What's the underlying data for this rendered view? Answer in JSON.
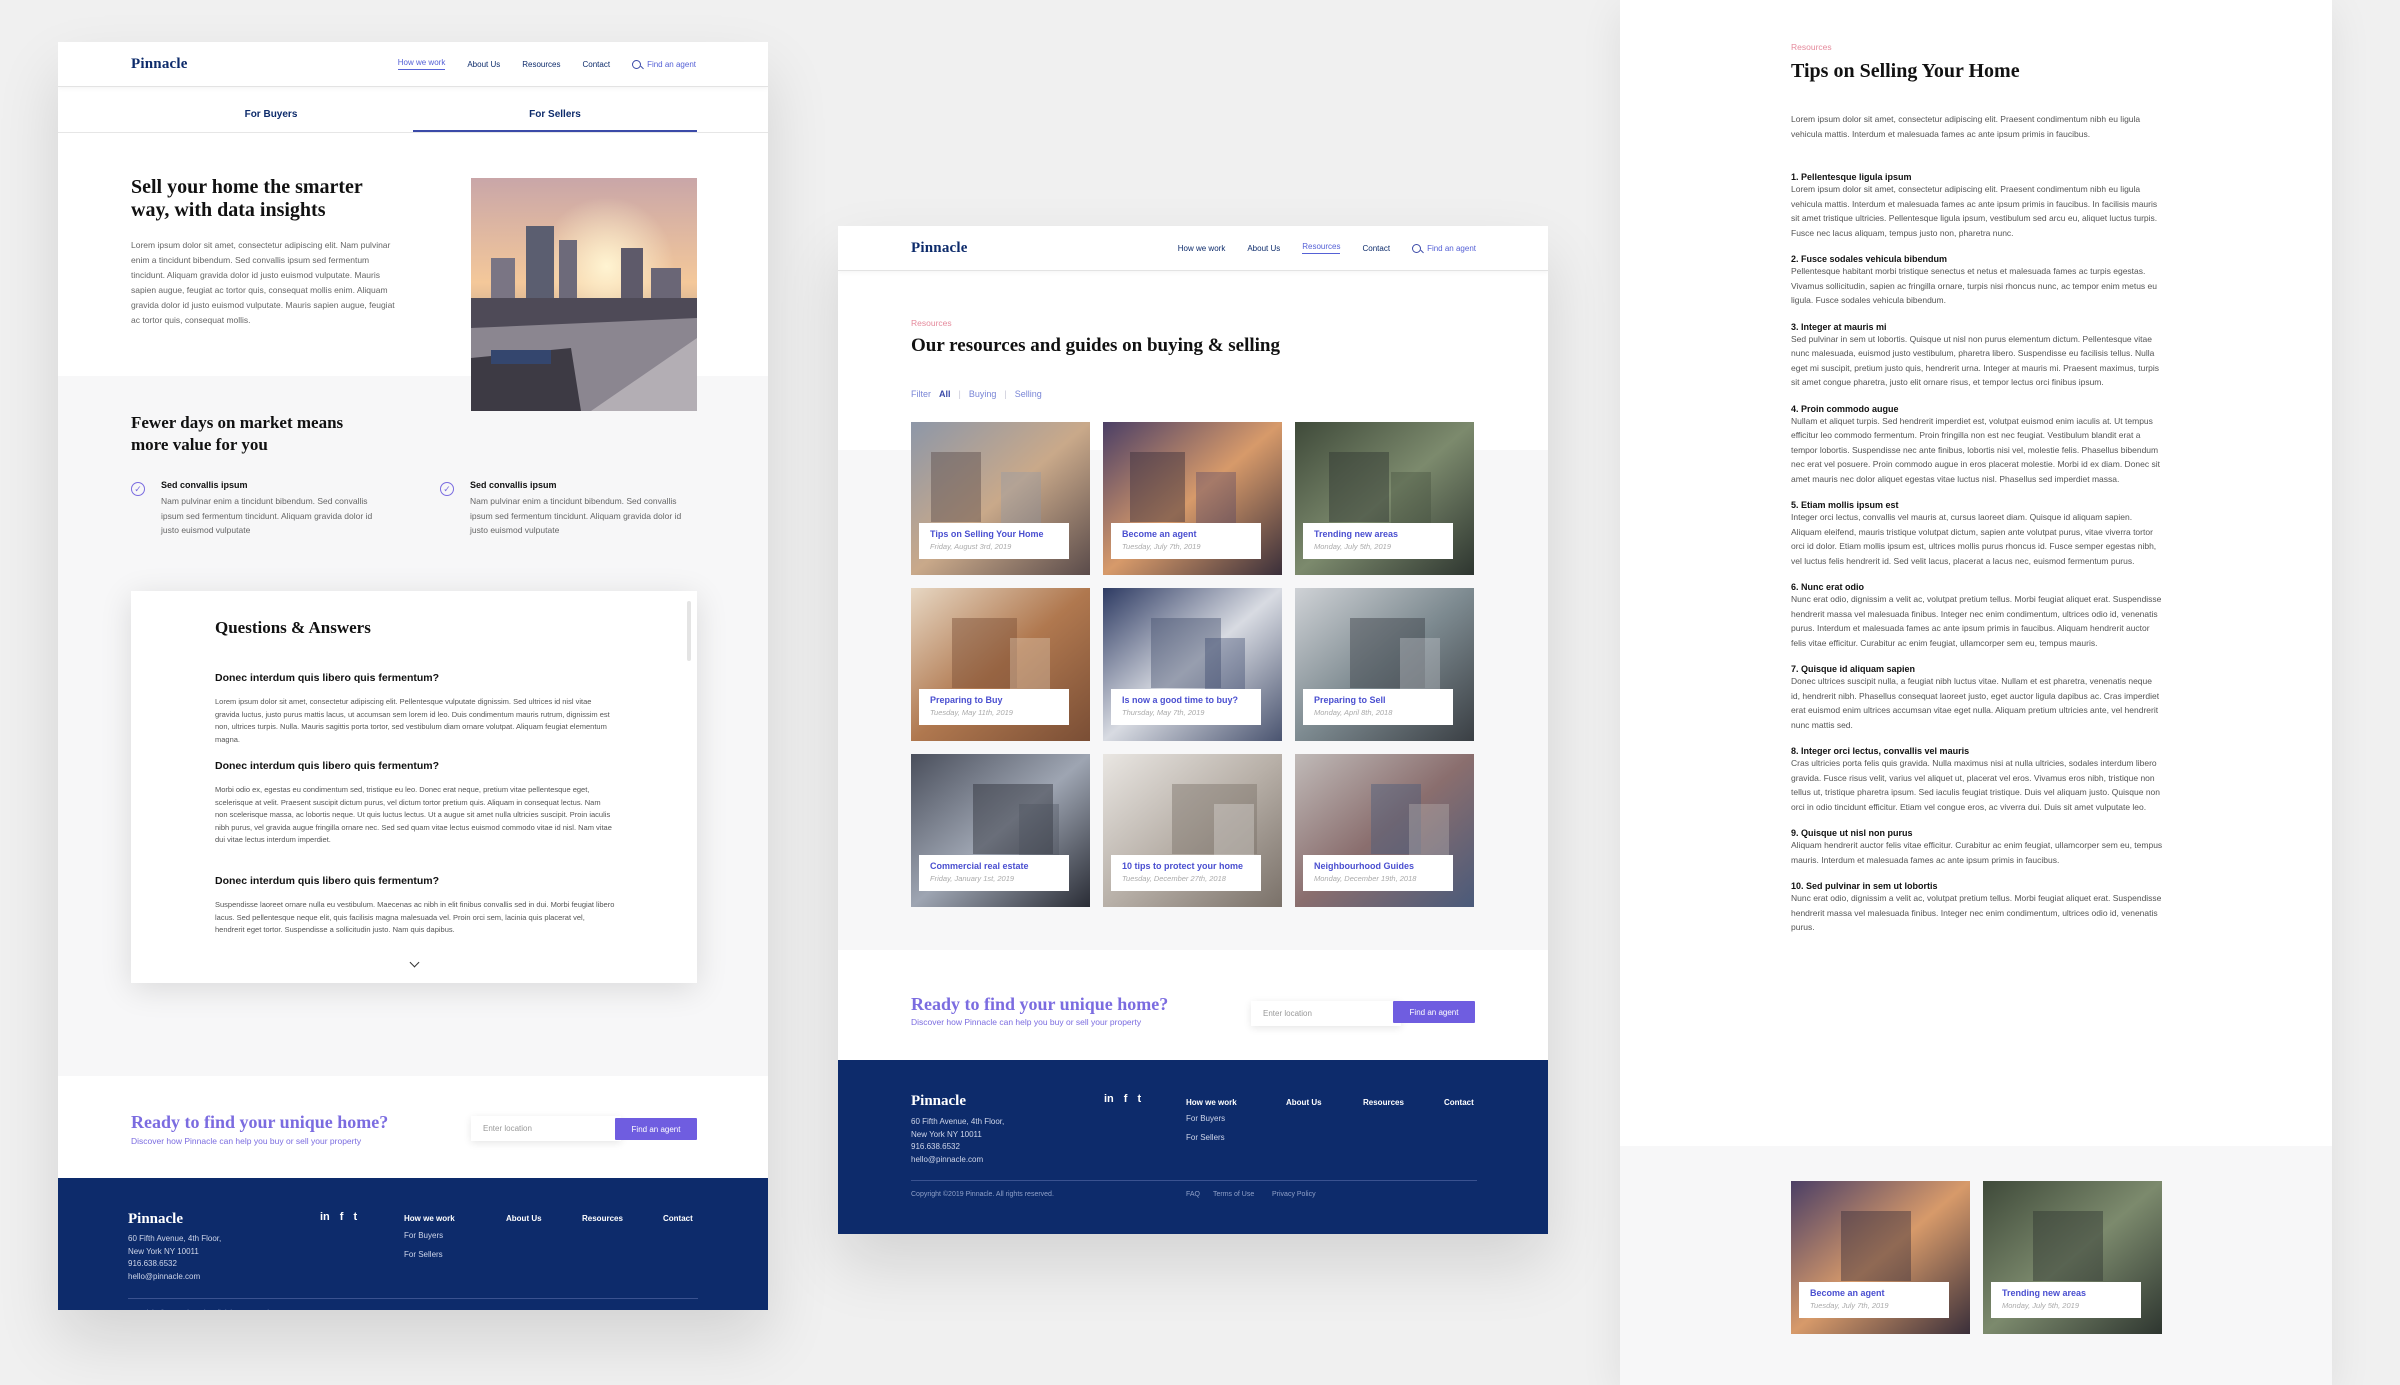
{
  "brand": "Pinnacle",
  "nav": {
    "how_we_work": "How we work",
    "about_us": "About Us",
    "resources": "Resources",
    "contact": "Contact",
    "find_agent": "Find an agent"
  },
  "sellers_page": {
    "tabs": [
      "For Buyers",
      "For Sellers"
    ],
    "hero_title": "Sell your home the smarter way, with data insights",
    "hero_body": "Lorem ipsum dolor sit amet, consectetur adipiscing elit. Nam pulvinar enim a tincidunt bibendum. Sed convallis ipsum sed fermentum tincidunt. Aliquam gravida dolor id justo euismod vulputate. Mauris sapien augue, feugiat ac tortor quis, consequat mollis enim. Aliquam gravida dolor id justo euismod vulputate. Mauris sapien augue, feugiat ac tortor quis, consequat mollis.",
    "section_title": "Fewer days on market means more value for you",
    "features": [
      {
        "title": "Sed convallis ipsum",
        "body": "Nam pulvinar enim a tincidunt bibendum. Sed convallis ipsum sed fermentum tincidunt. Aliquam gravida dolor id justo euismod vulputate"
      },
      {
        "title": "Sed convallis ipsum",
        "body": "Nam pulvinar enim a tincidunt bibendum. Sed convallis ipsum sed fermentum tincidunt. Aliquam gravida dolor id justo euismod vulputate"
      }
    ],
    "qa_title": "Questions & Answers",
    "qa": [
      {
        "q": "Donec interdum quis libero quis fermentum?",
        "a": "Lorem ipsum dolor sit amet, consectetur adipiscing elit. Pellentesque vulputate dignissim. Sed ultrices id nisl vitae gravida luctus, justo purus mattis lacus, ut accumsan sem lorem id leo. Duis condimentum mauris rutrum, dignissim est non, ultrices turpis. Nulla. Mauris sagittis porta tortor, sed vestibulum diam ornare volutpat. Aliquam feugiat elementum magna."
      },
      {
        "q": "Donec interdum quis libero quis fermentum?",
        "a": "Morbi odio ex, egestas eu condimentum sed, tristique eu leo. Donec erat neque, pretium vitae pellentesque eget, scelerisque at velit. Praesent suscipit dictum purus, vel dictum tortor pretium quis. Aliquam in consequat lectus. Nam non scelerisque massa, ac lobortis neque. Ut quis luctus lectus. Ut a augue sit amet nulla ultricies suscipit. Proin iaculis nibh purus, vel gravida augue fringilla ornare nec. Sed sed quam vitae lectus euismod commodo vitae id nisl. Nam vitae dui vitae lectus interdum imperdiet."
      },
      {
        "q": "Donec interdum quis libero quis fermentum?",
        "a": "Suspendisse laoreet ornare nulla eu vestibulum. Maecenas ac nibh in elit finibus convallis sed in dui. Morbi feugiat libero lacus. Sed pellentesque neque elit, quis facilisis magna malesuada vel. Proin orci sem, lacinia quis placerat vel, hendrerit eget tortor. Suspendisse a sollicitudin justo. Nam quis dapibus."
      }
    ]
  },
  "cta": {
    "title": "Ready to find your unique home?",
    "subtitle": "Discover how Pinnacle can help you buy or sell your property",
    "placeholder": "Enter location",
    "button": "Find an agent"
  },
  "footer": {
    "address": [
      "60 Fifth Avenue, 4th Floor,",
      "New York NY 10011",
      "916.638.6532",
      "hello@pinnacle.com"
    ],
    "social": [
      "in",
      "f",
      "t"
    ],
    "cols": [
      "How we work",
      "About Us",
      "Resources",
      "Contact"
    ],
    "how_sub": [
      "For Buyers",
      "For Sellers"
    ],
    "copyright": "Copyright ©2019 Pinnacle. All rights reserved.",
    "links": [
      "FAQ",
      "Terms of Use",
      "Privacy Policy"
    ]
  },
  "resources_page": {
    "crumb": "Resources",
    "title": "Our resources and guides on buying & selling",
    "filters": [
      "Filter",
      "All",
      "Buying",
      "Selling"
    ],
    "tiles": [
      {
        "title": "Tips on Selling Your Home",
        "date": "Friday, August 3rd, 2019",
        "icon": "apartment-complex-photo"
      },
      {
        "title": "Become an agent",
        "date": "Tuesday, July 7th, 2019",
        "icon": "modern-house-photo"
      },
      {
        "title": "Trending new areas",
        "date": "Monday, July 5th, 2019",
        "icon": "aerial-houses-photo"
      },
      {
        "title": "Preparing to Buy",
        "date": "Tuesday, May 11th, 2019",
        "icon": "living-room-photo"
      },
      {
        "title": "Is now a good time to buy?",
        "date": "Thursday, May 7th, 2019",
        "icon": "building-corner-photo"
      },
      {
        "title": "Preparing to Sell",
        "date": "Monday, April 8th, 2018",
        "icon": "staircase-photo"
      },
      {
        "title": "Commercial real estate",
        "date": "Friday, January 1st, 2019",
        "icon": "office-windows-photo"
      },
      {
        "title": "10 tips to protect your home",
        "date": "Tuesday, December 27th, 2018",
        "icon": "kitchen-photo"
      },
      {
        "title": "Neighbourhood Guides",
        "date": "Monday, December 19th, 2018",
        "icon": "rooftops-photo"
      }
    ]
  },
  "article_page": {
    "crumb": "Resources",
    "title": "Tips on Selling Your Home",
    "intro": "Lorem ipsum dolor sit amet, consectetur adipiscing elit. Praesent condimentum nibh eu ligula vehicula mattis. Interdum et malesuada fames ac ante ipsum primis in faucibus.",
    "sections": [
      {
        "h": "1. Pellentesque ligula ipsum",
        "p": "Lorem ipsum dolor sit amet, consectetur adipiscing elit. Praesent condimentum nibh eu ligula vehicula mattis. Interdum et malesuada fames ac ante ipsum primis in faucibus. In facilisis mauris sit amet tristique ultricies. Pellentesque ligula ipsum, vestibulum sed arcu eu, aliquet luctus turpis. Fusce nec lacus aliquam, tempus justo non, pharetra nunc."
      },
      {
        "h": "2. Fusce sodales vehicula bibendum",
        "p": "Pellentesque habitant morbi tristique senectus et netus et malesuada fames ac turpis egestas. Vivamus sollicitudin, sapien ac fringilla ornare, turpis nisi rhoncus nunc, ac tempor enim metus eu ligula. Fusce sodales vehicula bibendum."
      },
      {
        "h": "3. Integer at mauris mi",
        "p": "Sed pulvinar in sem ut lobortis. Quisque ut nisl non purus elementum dictum. Pellentesque vitae nunc malesuada, euismod justo vestibulum, pharetra libero. Suspendisse eu facilisis tellus. Nulla eget mi suscipit, pretium justo quis, hendrerit urna. Integer at mauris mi. Praesent maximus, turpis sit amet congue pharetra, justo elit ornare risus, et tempor lectus orci finibus ipsum."
      },
      {
        "h": "4. Proin commodo augue",
        "p": "Nullam et aliquet turpis. Sed hendrerit imperdiet est, volutpat euismod enim iaculis at. Ut tempus efficitur leo commodo fermentum. Proin fringilla non est nec feugiat. Vestibulum blandit erat a tempor lobortis. Suspendisse nec ante finibus, lobortis nisi vel, molestie felis. Phasellus bibendum nec erat vel posuere. Proin commodo augue in eros placerat molestie. Morbi id ex diam. Donec sit amet mauris nec dolor aliquet egestas vitae luctus nisl. Phasellus sed imperdiet massa."
      },
      {
        "h": "5. Etiam mollis ipsum est",
        "p": "Integer orci lectus, convallis vel mauris at, cursus laoreet diam. Quisque id aliquam sapien. Aliquam eleifend, mauris tristique volutpat dictum, sapien ante volutpat purus, vitae viverra tortor orci id dolor. Etiam mollis ipsum est, ultrices mollis purus rhoncus id. Fusce semper egestas nibh, vel luctus felis hendrerit id. Sed velit lacus, placerat a lacus nec, euismod fermentum purus."
      },
      {
        "h": "6. Nunc erat odio",
        "p": "Nunc erat odio, dignissim a velit ac, volutpat pretium tellus. Morbi feugiat aliquet erat. Suspendisse hendrerit massa vel malesuada finibus. Integer nec enim condimentum, ultrices odio id, venenatis purus. Interdum et malesuada fames ac ante ipsum primis in faucibus. Aliquam hendrerit auctor felis vitae efficitur. Curabitur ac enim feugiat, ullamcorper sem eu, tempus mauris."
      },
      {
        "h": "7. Quisque id aliquam sapien",
        "p": "Donec ultrices suscipit nulla, a feugiat nibh luctus vitae. Nullam et est pharetra, venenatis neque id, hendrerit nibh. Phasellus consequat laoreet justo, eget auctor ligula dapibus ac. Cras imperdiet erat euismod enim ultrices accumsan vitae eget nulla. Aliquam pretium ultricies ante, vel hendrerit nunc mattis sed."
      },
      {
        "h": "8. Integer orci lectus, convallis vel mauris",
        "p": "Cras ultricies porta felis quis gravida. Nulla maximus nisi at nulla ultricies, sodales interdum libero gravida. Fusce risus velit, varius vel aliquet ut, placerat vel eros. Vivamus eros nibh, tristique non tellus ut, tristique pharetra ipsum. Sed iaculis feugiat tristique. Duis vel aliquam justo. Quisque non orci in odio tincidunt efficitur. Etiam vel congue eros, ac viverra dui. Duis sit amet vulputate leo."
      },
      {
        "h": "9. Quisque ut nisl non purus",
        "p": "Aliquam hendrerit auctor felis vitae efficitur. Curabitur ac enim feugiat, ullamcorper sem eu, tempus mauris. Interdum et malesuada fames ac ante ipsum primis in faucibus."
      },
      {
        "h": "10. Sed pulvinar in sem ut lobortis",
        "p": "Nunc erat odio, dignissim a velit ac, volutpat pretium tellus. Morbi feugiat aliquet erat. Suspendisse hendrerit massa vel malesuada finibus. Integer nec enim condimentum, ultrices odio id, venenatis purus."
      }
    ],
    "related": [
      {
        "title": "Become an agent",
        "date": "Tuesday, July 7th, 2019"
      },
      {
        "title": "Trending new areas",
        "date": "Monday, July 5th, 2019"
      }
    ]
  }
}
